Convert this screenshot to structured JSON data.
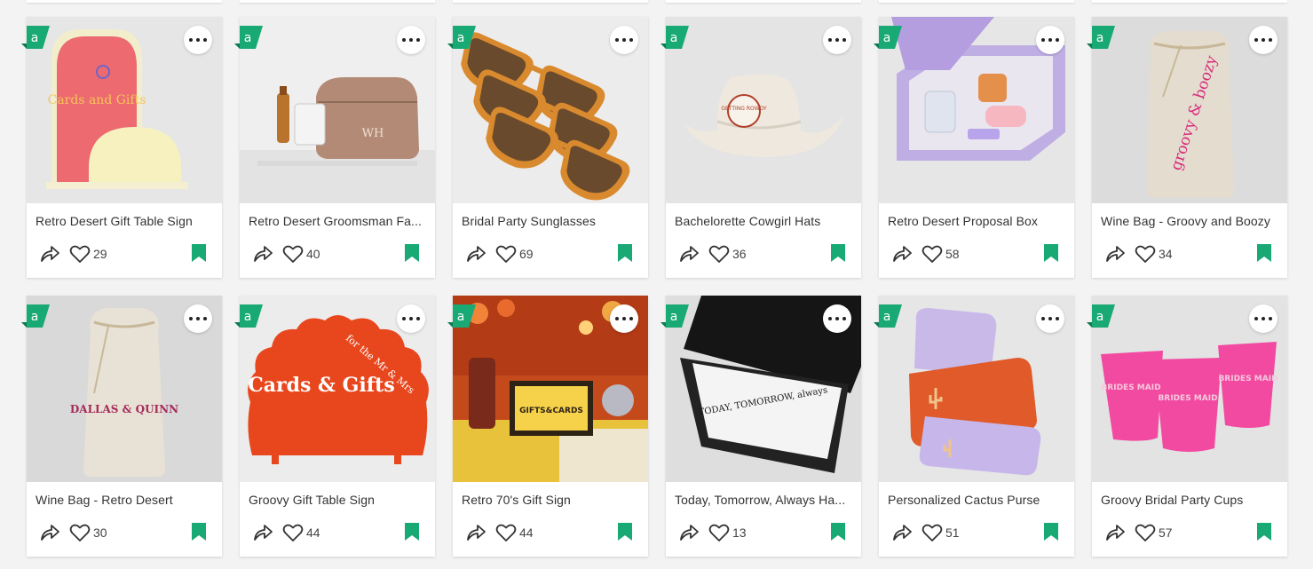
{
  "accent": "#19a974",
  "badge_glyph": "a",
  "products": [
    {
      "title": "Retro Desert Gift Table Sign",
      "likes": "29",
      "image": "cards-and-gifts-arch-sign",
      "bg": "#e6e6e6",
      "sign_text": "Cards and Gifts"
    },
    {
      "title": "Retro Desert Groomsman Fa...",
      "likes": "40",
      "image": "leather-dopp-kit",
      "bg": "#e3e3e3",
      "sign_text": "WH"
    },
    {
      "title": "Bridal Party Sunglasses",
      "likes": "69",
      "image": "orange-sunglasses",
      "bg": "#ececec"
    },
    {
      "title": "Bachelorette Cowgirl Hats",
      "likes": "36",
      "image": "white-cowgirl-hat",
      "bg": "#e4e4e4",
      "sign_text": "GETTING ROWDY"
    },
    {
      "title": "Retro Desert Proposal Box",
      "likes": "58",
      "image": "lavender-gift-box",
      "bg": "#e6e6e6"
    },
    {
      "title": "Wine Bag - Groovy and Boozy",
      "likes": "34",
      "image": "wine-bag-groovy",
      "bg": "#dcdcdc",
      "sign_text": "groovy & boozy"
    },
    {
      "title": "Wine Bag - Retro Desert",
      "likes": "30",
      "image": "wine-bag-dallas",
      "bg": "#d9d9d9",
      "sign_text": "DALLAS & QUINN"
    },
    {
      "title": "Groovy Gift Table Sign",
      "likes": "44",
      "image": "orange-scalloped-sign",
      "bg": "#ececec",
      "sign_text": "Cards & Gifts",
      "sign_sub": "for the Mr & Mrs"
    },
    {
      "title": "Retro 70's Gift Sign",
      "likes": "44",
      "image": "retro-table-scene",
      "bg": "#c44a1c",
      "sign_text": "GIFTS&CARDS"
    },
    {
      "title": "Today, Tomorrow, Always Ha...",
      "likes": "13",
      "image": "black-box-card",
      "bg": "#dedede",
      "sign_text": "TODAY, TOMORROW, always"
    },
    {
      "title": "Personalized Cactus Purse",
      "likes": "51",
      "image": "cactus-pouches",
      "bg": "#e6e6e6"
    },
    {
      "title": "Groovy Bridal Party Cups",
      "likes": "57",
      "image": "pink-cups",
      "bg": "#e3e3e3",
      "sign_text": "BRIDES MAID"
    }
  ]
}
